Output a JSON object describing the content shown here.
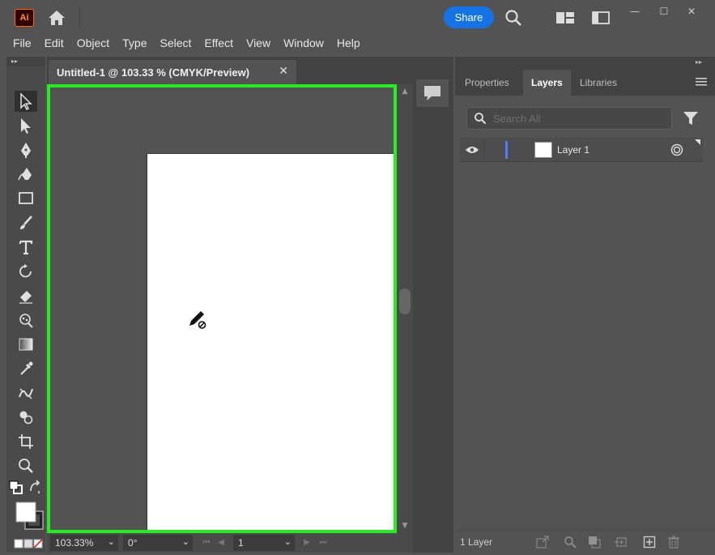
{
  "app": {
    "logo_text": "Ai",
    "share_label": "Share",
    "window_buttons": [
      "—",
      "☐",
      "✕"
    ]
  },
  "menu": [
    "File",
    "Edit",
    "Object",
    "Type",
    "Select",
    "Effect",
    "View",
    "Window",
    "Help"
  ],
  "document": {
    "tab_title": "Untitled-1 @ 103.33 % (CMYK/Preview)",
    "close": "✕"
  },
  "status": {
    "zoom": "103.33%",
    "rotation": "0°",
    "artboard_number": "1"
  },
  "right_panel": {
    "tabs": [
      "Properties",
      "Layers",
      "Libraries"
    ],
    "active_tab": "Layers",
    "search_placeholder": "Search All",
    "layers": [
      {
        "name": "Layer 1",
        "color": "#4f7bff"
      }
    ],
    "layer_count": "1 Layer"
  },
  "colors": {
    "accent": "#1473e6",
    "highlight": "#22ee22"
  }
}
